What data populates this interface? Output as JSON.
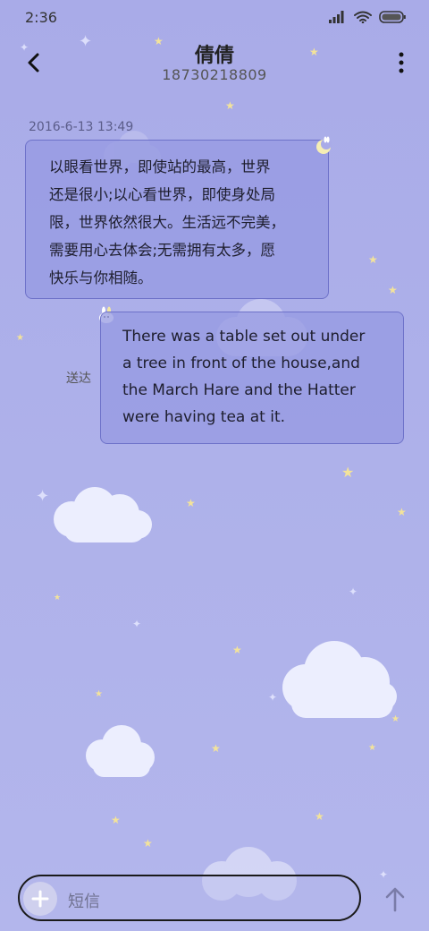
{
  "status_bar": {
    "time": "2:36",
    "icons": [
      "signal-icon",
      "wifi-icon",
      "battery-icon"
    ]
  },
  "header": {
    "contact_name": "倩倩",
    "phone_number": "18730218809"
  },
  "messages": [
    {
      "direction": "incoming",
      "timestamp": "2016-6-13 13:49",
      "lines": [
        "以眼看世界，即使站的最高，世界",
        "还是很小;以心看世界，即使身处局",
        "限，世界依然很大。生活远不完美，",
        "需要用心去体会;无需拥有太多，愿",
        "快乐与你相随。"
      ]
    },
    {
      "direction": "outgoing",
      "status": "送达",
      "lines": [
        "There was a table set out under",
        "a tree in front of the house,and",
        "the March Hare and the Hatter",
        "were having tea at it."
      ]
    }
  ],
  "compose": {
    "placeholder": "短信"
  },
  "colors": {
    "background": "#aeb1ea",
    "bubble_fill": "#969ae2",
    "bubble_border": "#6e72c9"
  }
}
